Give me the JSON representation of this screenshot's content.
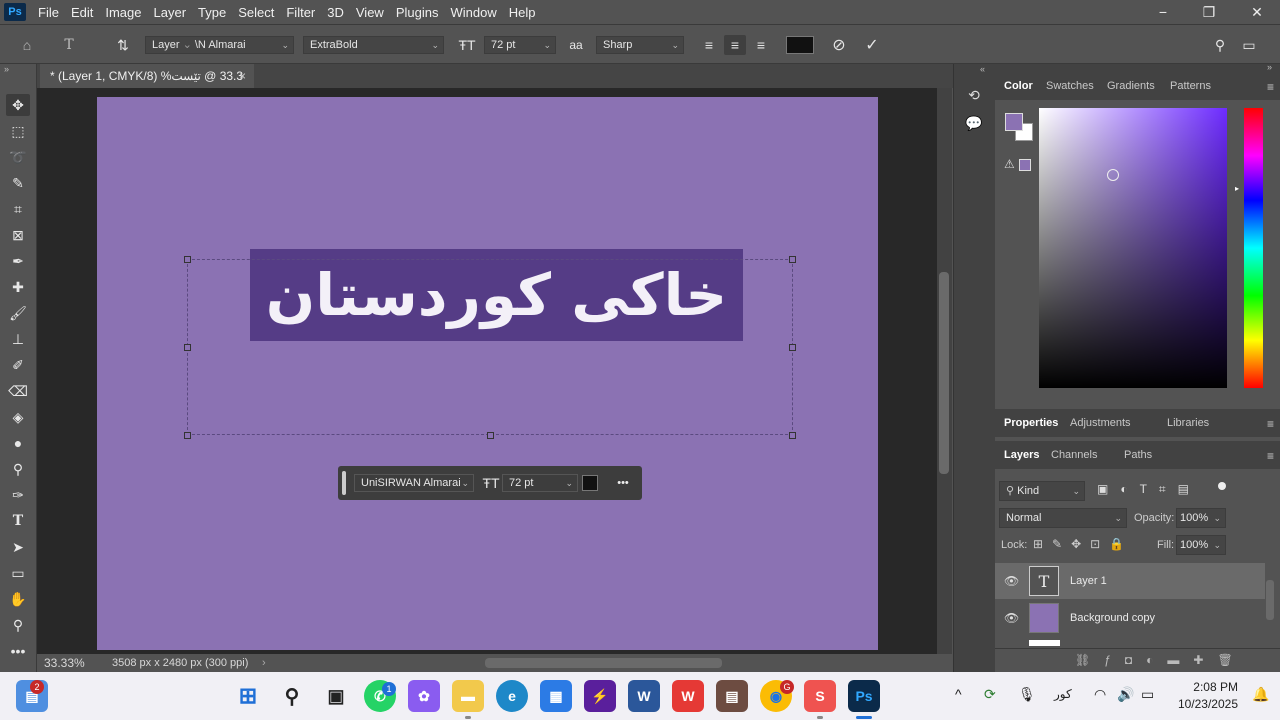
{
  "menubar": {
    "app_logo": "Ps",
    "items": [
      "File",
      "Edit",
      "Image",
      "Layer",
      "Type",
      "Select",
      "Filter",
      "3D",
      "View",
      "Plugins",
      "Window",
      "Help"
    ],
    "window_controls": {
      "minimize": "−",
      "restore": "❐",
      "close": "✕"
    }
  },
  "options": {
    "font_family_short": "Layer",
    "font_family_tail": "\\N Almarai",
    "font_style": "ExtraBold",
    "font_size": "72 pt",
    "antialias_label": "aa",
    "antialias": "Sharp",
    "text_color": "#111111"
  },
  "document": {
    "tab_title": "33.3 @ تێست% (Layer 1, CMYK/8) *",
    "tab_close": "×",
    "canvas_color": "#8b72b3",
    "text_highlight_color": "#553c86",
    "text": "خاکی کوردستان",
    "zoom": "33.33%",
    "doc_info": "3508 px x 2480 px (300 ppi)"
  },
  "context_bar": {
    "font": "UniSIRWAN Almarai",
    "size": "72 pt",
    "more": "•••"
  },
  "color_panel": {
    "tabs": [
      "Color",
      "Swatches",
      "Gradients",
      "Patterns"
    ],
    "active_tab": "Color",
    "foreground": "#8b72b3",
    "background": "#ffffff"
  },
  "properties_panel": {
    "tabs": [
      "Properties",
      "Adjustments",
      "Libraries"
    ],
    "active_tab": "Properties"
  },
  "layers_panel": {
    "tabs": [
      "Layers",
      "Channels",
      "Paths"
    ],
    "active_tab": "Layers",
    "filter_kind": "Kind",
    "blend_mode": "Normal",
    "opacity_label": "Opacity:",
    "opacity": "100%",
    "lock_label": "Lock:",
    "fill_label": "Fill:",
    "fill": "100%",
    "layers": [
      {
        "name": "Layer 1",
        "type": "text",
        "selected": true
      },
      {
        "name": "Background copy",
        "type": "fill",
        "selected": false
      }
    ]
  },
  "taskbar": {
    "widget_badge": "2",
    "whatsapp_badge": "1",
    "chrome_badge": "G",
    "language": "کور",
    "time": "2:08 PM",
    "date": "10/23/2025"
  }
}
